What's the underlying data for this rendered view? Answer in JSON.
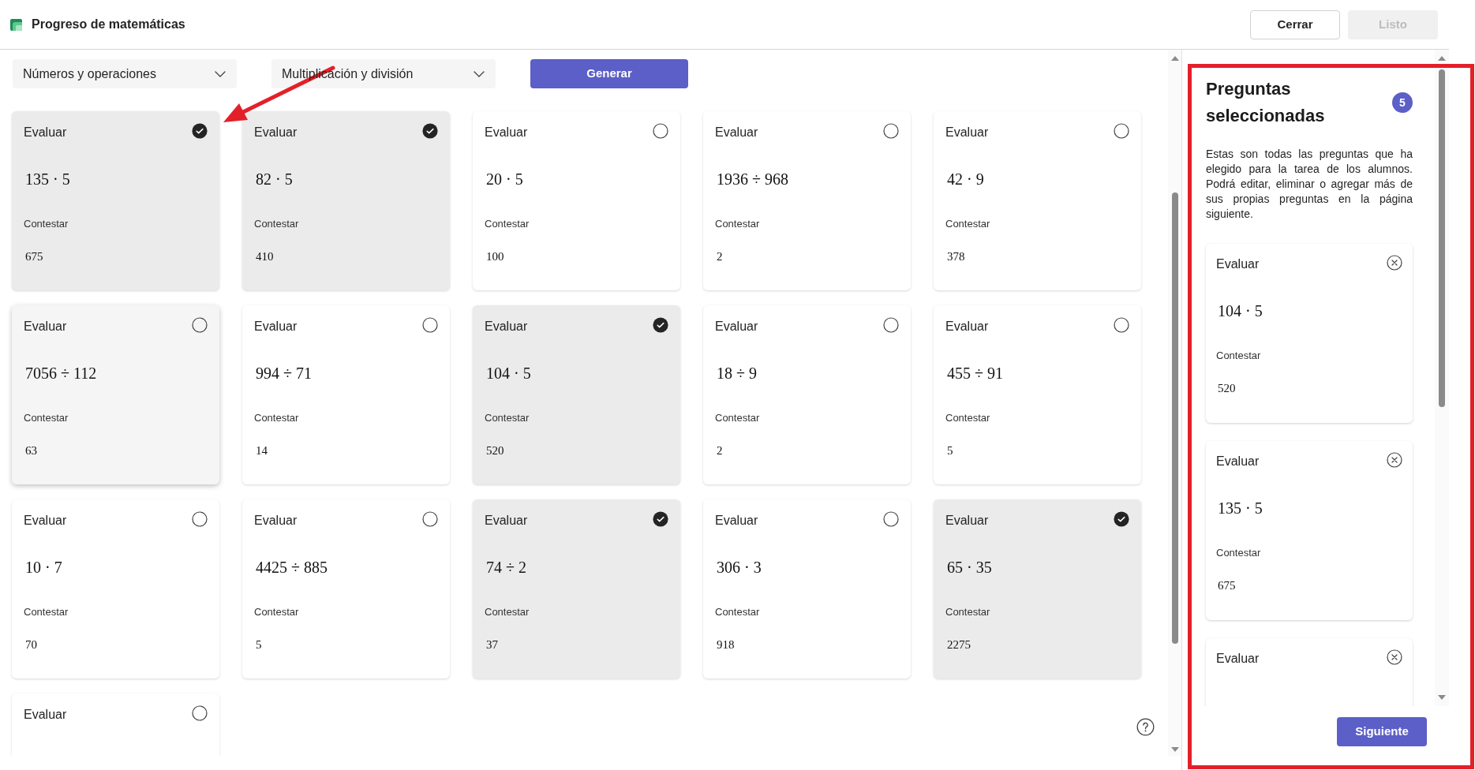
{
  "header": {
    "title": "Progreso de matemáticas",
    "buttons": [
      {
        "label": "Cerrar",
        "disabled": false
      },
      {
        "label": "Listo",
        "disabled": true
      }
    ]
  },
  "filters": {
    "dropdowns": [
      {
        "value": "Números y operaciones"
      },
      {
        "value": "Multiplicación y división"
      }
    ],
    "generate_button": "Generar"
  },
  "questions": [
    {
      "prompt": "Evaluar",
      "expression": "135 · 5",
      "answer_label": "Contestar",
      "answer": "675",
      "selected": true,
      "hovered": false
    },
    {
      "prompt": "Evaluar",
      "expression": "82 · 5",
      "answer_label": "Contestar",
      "answer": "410",
      "selected": true,
      "hovered": false
    },
    {
      "prompt": "Evaluar",
      "expression": "20 · 5",
      "answer_label": "Contestar",
      "answer": "100",
      "selected": false,
      "hovered": false
    },
    {
      "prompt": "Evaluar",
      "expression": "1936 ÷ 968",
      "answer_label": "Contestar",
      "answer": "2",
      "selected": false,
      "hovered": false
    },
    {
      "prompt": "Evaluar",
      "expression": "42 · 9",
      "answer_label": "Contestar",
      "answer": "378",
      "selected": false,
      "hovered": false
    },
    {
      "prompt": "Evaluar",
      "expression": "7056 ÷ 112",
      "answer_label": "Contestar",
      "answer": "63",
      "selected": false,
      "hovered": true
    },
    {
      "prompt": "Evaluar",
      "expression": "994 ÷ 71",
      "answer_label": "Contestar",
      "answer": "14",
      "selected": false,
      "hovered": false
    },
    {
      "prompt": "Evaluar",
      "expression": "104 · 5",
      "answer_label": "Contestar",
      "answer": "520",
      "selected": true,
      "hovered": false
    },
    {
      "prompt": "Evaluar",
      "expression": "18 ÷ 9",
      "answer_label": "Contestar",
      "answer": "2",
      "selected": false,
      "hovered": false
    },
    {
      "prompt": "Evaluar",
      "expression": "455 ÷ 91",
      "answer_label": "Contestar",
      "answer": "5",
      "selected": false,
      "hovered": false
    },
    {
      "prompt": "Evaluar",
      "expression": "10 · 7",
      "answer_label": "Contestar",
      "answer": "70",
      "selected": false,
      "hovered": false
    },
    {
      "prompt": "Evaluar",
      "expression": "4425 ÷ 885",
      "answer_label": "Contestar",
      "answer": "5",
      "selected": false,
      "hovered": false
    },
    {
      "prompt": "Evaluar",
      "expression": "74 ÷ 2",
      "answer_label": "Contestar",
      "answer": "37",
      "selected": true,
      "hovered": false
    },
    {
      "prompt": "Evaluar",
      "expression": "306 · 3",
      "answer_label": "Contestar",
      "answer": "918",
      "selected": false,
      "hovered": false
    },
    {
      "prompt": "Evaluar",
      "expression": "65 · 35",
      "answer_label": "Contestar",
      "answer": "2275",
      "selected": true,
      "hovered": false
    },
    {
      "prompt": "Evaluar",
      "selected": false,
      "hovered": false
    }
  ],
  "selected_panel": {
    "title": "Preguntas seleccionadas",
    "count": "5",
    "description": "Estas son todas las preguntas que ha elegido para la tarea de los alumnos. Podrá editar, eliminar o agregar más de sus propias preguntas en la página siguiente.",
    "questions": [
      {
        "prompt": "Evaluar",
        "expression": "104 · 5",
        "answer_label": "Contestar",
        "answer": "520"
      },
      {
        "prompt": "Evaluar",
        "expression": "135 · 5",
        "answer_label": "Contestar",
        "answer": "675"
      },
      {
        "prompt": "Evaluar"
      }
    ],
    "next_button": "Siguiente"
  },
  "annotations": {
    "arrow": true,
    "frame": true
  }
}
